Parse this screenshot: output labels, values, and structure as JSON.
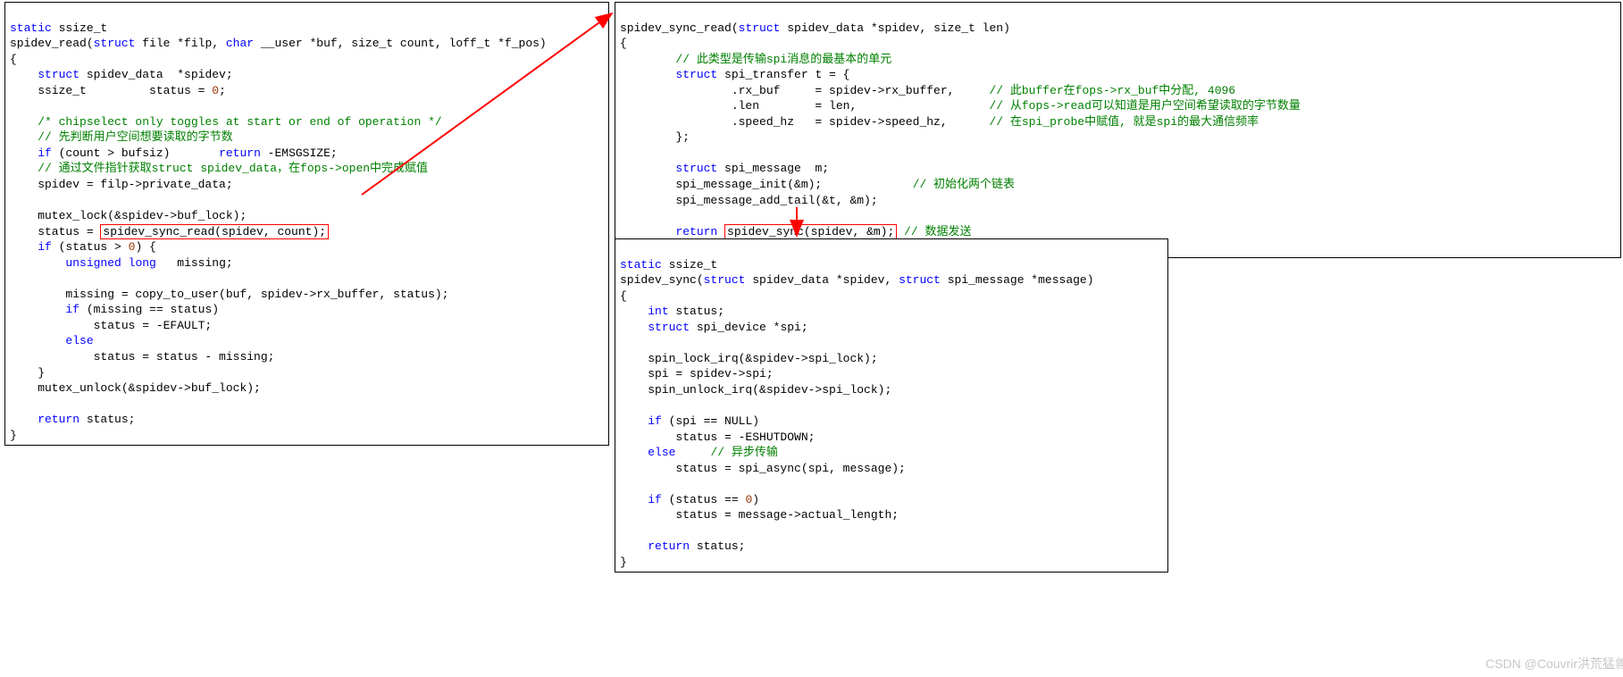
{
  "box1": {
    "l1a": "static",
    "l1b": " ssize_t",
    "l2a": "spidev_read(",
    "l2b": "struct",
    "l2c": " file *filp, ",
    "l2d": "char",
    "l2e": " __user *buf, size_t count, loff_t *f_pos)",
    "l3": "{",
    "l4a": "    ",
    "l4b": "struct",
    "l4c": " spidev_data  *spidev;",
    "l5a": "    ssize_t         status = ",
    "l5b": "0",
    "l5c": ";",
    "l6": " ",
    "l7": "    /* chipselect only toggles at start or end of operation */",
    "l8": "    // 先判断用户空间想要读取的字节数",
    "l9a": "    ",
    "l9b": "if",
    "l9c": " (count > bufsiz)       ",
    "l9d": "return",
    "l9e": " -EMSGSIZE;",
    "l10": "    // 通过文件指针获取struct spidev_data，在fops->open中完成赋值",
    "l11": "    spidev = filp->private_data;",
    "l12": " ",
    "l13": "    mutex_lock(&spidev->buf_lock);",
    "l14a": "    status = ",
    "l14b": "spidev_sync_read(spidev, count);",
    "l15a": "    ",
    "l15b": "if",
    "l15c": " (status > ",
    "l15d": "0",
    "l15e": ") {",
    "l16a": "        ",
    "l16b": "unsigned",
    "l16c": " ",
    "l16d": "long",
    "l16e": "   missing;",
    "l17": " ",
    "l18": "        missing = copy_to_user(buf, spidev->rx_buffer, status);",
    "l19a": "        ",
    "l19b": "if",
    "l19c": " (missing == status)",
    "l20": "            status = -EFAULT;",
    "l21a": "        ",
    "l21b": "else",
    "l22": "            status = status - missing;",
    "l23": "    }",
    "l24": "    mutex_unlock(&spidev->buf_lock);",
    "l25": " ",
    "l26a": "    ",
    "l26b": "return",
    "l26c": " status;",
    "l27": "}"
  },
  "box2": {
    "l1a": "spidev_sync_read(",
    "l1b": "struct",
    "l1c": " spidev_data *spidev, size_t len)",
    "l2": "{",
    "l3": "        // 此类型是传输spi消息的最基本的单元",
    "l4a": "        ",
    "l4b": "struct",
    "l4c": " spi_transfer t = {",
    "l5a": "                .rx_buf     = spidev->rx_buffer,     ",
    "l5b": "// 此buffer在fops->rx_buf中分配, 4096",
    "l6a": "                .len        = len,                   ",
    "l6b": "// 从fops->read可以知道是用户空间希望读取的字节数量",
    "l7a": "                .speed_hz   = spidev->speed_hz,      ",
    "l7b": "// 在spi_probe中赋值, 就是spi的最大通信频率",
    "l8": "        };",
    "l9": " ",
    "l10a": "        ",
    "l10b": "struct",
    "l10c": " spi_message  m;",
    "l11a": "        spi_message_init(&m);             ",
    "l11b": "// 初始化两个链表",
    "l12": "        spi_message_add_tail(&t, &m);",
    "l13": " ",
    "l14a": "        ",
    "l14b": "return",
    "l14c": " ",
    "l14d": "spidev_sync(spidev, &m);",
    "l14e": " // 数据发送",
    "l15": "}"
  },
  "box3": {
    "l1a": "static",
    "l1b": " ssize_t",
    "l2a": "spidev_sync(",
    "l2b": "struct",
    "l2c": " spidev_data *spidev, ",
    "l2d": "struct",
    "l2e": " spi_message *message)",
    "l3": "{",
    "l4a": "    ",
    "l4b": "int",
    "l4c": " status;",
    "l5a": "    ",
    "l5b": "struct",
    "l5c": " spi_device *spi;",
    "l6": " ",
    "l7": "    spin_lock_irq(&spidev->spi_lock);",
    "l8": "    spi = spidev->spi;",
    "l9": "    spin_unlock_irq(&spidev->spi_lock);",
    "l10": " ",
    "l11a": "    ",
    "l11b": "if",
    "l11c": " (spi == NULL)",
    "l12": "        status = -ESHUTDOWN;",
    "l13a": "    ",
    "l13b": "else",
    "l13c": "     ",
    "l13d": "// 异步传输",
    "l14": "        status = spi_async(spi, message);",
    "l15": " ",
    "l16a": "    ",
    "l16b": "if",
    "l16c": " (status == ",
    "l16d": "0",
    "l16e": ")",
    "l17": "        status = message->actual_length;",
    "l18": " ",
    "l19a": "    ",
    "l19b": "return",
    "l19c": " status;",
    "l20": "}"
  },
  "watermark": "CSDN @Couvrir洪荒猛兽"
}
